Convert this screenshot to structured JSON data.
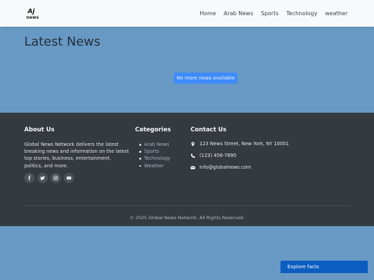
{
  "navbar": {
    "logo_top": "Aj",
    "logo_bottom": "news",
    "links": [
      "Home",
      "Arab News",
      "Sports",
      "Technology",
      "weather"
    ]
  },
  "main": {
    "title": "Latest News",
    "no_more_label": "No more news available"
  },
  "footer": {
    "about": {
      "heading": "About Us",
      "text": "Global News Network delivers the latest breaking news and information on the latest top stories, business, entertainment, politics, and more.",
      "socials": [
        "facebook-icon",
        "twitter-icon",
        "instagram-icon",
        "youtube-icon"
      ]
    },
    "categories": {
      "heading": "Categories",
      "items": [
        "Arab News",
        "Sports",
        "Technology",
        "Weather"
      ]
    },
    "contact": {
      "heading": "Contact Us",
      "address": "123 News Street, New York, NY 10001",
      "phone": "(123) 456-7890",
      "email": "info@globalnews.com"
    },
    "copyright": "© 2025 Global News Network. All Rights Reserved."
  },
  "explore": {
    "label": "Explore facts"
  },
  "colors": {
    "page_background": "#6899c4",
    "footer_background": "#353a40",
    "button_blue": "#3d8bfd",
    "explore_blue": "#0d5cc0"
  }
}
